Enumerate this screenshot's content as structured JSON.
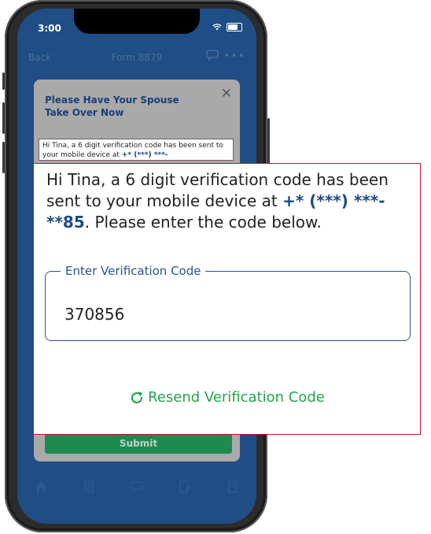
{
  "status": {
    "time": "3:00"
  },
  "nav": {
    "back_label": "Back",
    "title": "Form 8879",
    "chat_icon": "chat-icon",
    "more_icon": "more-icon"
  },
  "dialog": {
    "title": "Please Have Your Spouse Take Over Now",
    "body_prefix": "Hi Tina, a 6 digit verification code has been sent to your mobile device at",
    "body_number": "+* (***) ***-",
    "submit_label": "Submit"
  },
  "tabbar": {
    "icons": [
      "home-icon",
      "document-icon",
      "chat-icon",
      "edit-document-icon",
      "checklist-icon"
    ]
  },
  "zoom": {
    "message_prefix": "Hi Tina, a 6 digit verification code has been sent to your mobile device at",
    "masked_number": "+* (***) ***-**85",
    "message_suffix": ". Please enter the code below.",
    "field_label": "Enter Verification Code",
    "field_value": "370856",
    "resend_label": "Resend Verification Code"
  },
  "colors": {
    "primary_blue": "#1e4a86",
    "resend_green": "#23a34d",
    "callout_border": "#c8102e",
    "submit_green": "#1e8a4f"
  }
}
